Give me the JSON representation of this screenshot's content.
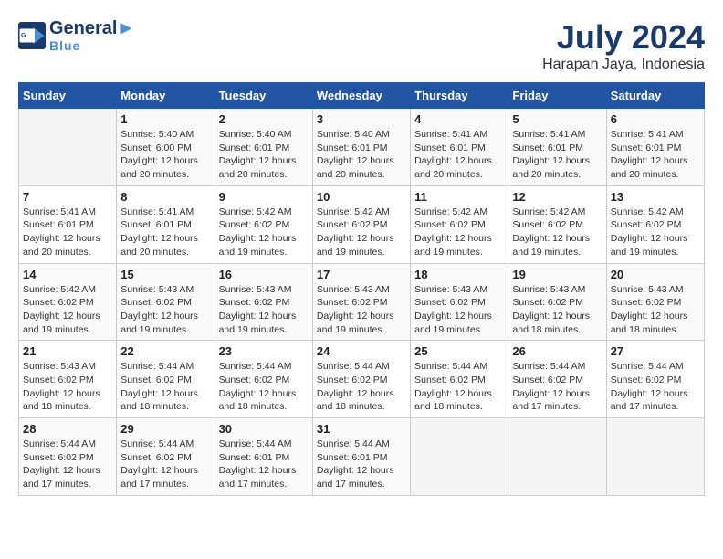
{
  "header": {
    "logo_line1": "General",
    "logo_line2": "Blue",
    "month": "July 2024",
    "location": "Harapan Jaya, Indonesia"
  },
  "weekdays": [
    "Sunday",
    "Monday",
    "Tuesday",
    "Wednesday",
    "Thursday",
    "Friday",
    "Saturday"
  ],
  "weeks": [
    [
      {
        "day": "",
        "info": ""
      },
      {
        "day": "1",
        "info": "Sunrise: 5:40 AM\nSunset: 6:00 PM\nDaylight: 12 hours\nand 20 minutes."
      },
      {
        "day": "2",
        "info": "Sunrise: 5:40 AM\nSunset: 6:01 PM\nDaylight: 12 hours\nand 20 minutes."
      },
      {
        "day": "3",
        "info": "Sunrise: 5:40 AM\nSunset: 6:01 PM\nDaylight: 12 hours\nand 20 minutes."
      },
      {
        "day": "4",
        "info": "Sunrise: 5:41 AM\nSunset: 6:01 PM\nDaylight: 12 hours\nand 20 minutes."
      },
      {
        "day": "5",
        "info": "Sunrise: 5:41 AM\nSunset: 6:01 PM\nDaylight: 12 hours\nand 20 minutes."
      },
      {
        "day": "6",
        "info": "Sunrise: 5:41 AM\nSunset: 6:01 PM\nDaylight: 12 hours\nand 20 minutes."
      }
    ],
    [
      {
        "day": "7",
        "info": "Sunrise: 5:41 AM\nSunset: 6:01 PM\nDaylight: 12 hours\nand 20 minutes."
      },
      {
        "day": "8",
        "info": "Sunrise: 5:41 AM\nSunset: 6:01 PM\nDaylight: 12 hours\nand 20 minutes."
      },
      {
        "day": "9",
        "info": "Sunrise: 5:42 AM\nSunset: 6:02 PM\nDaylight: 12 hours\nand 19 minutes."
      },
      {
        "day": "10",
        "info": "Sunrise: 5:42 AM\nSunset: 6:02 PM\nDaylight: 12 hours\nand 19 minutes."
      },
      {
        "day": "11",
        "info": "Sunrise: 5:42 AM\nSunset: 6:02 PM\nDaylight: 12 hours\nand 19 minutes."
      },
      {
        "day": "12",
        "info": "Sunrise: 5:42 AM\nSunset: 6:02 PM\nDaylight: 12 hours\nand 19 minutes."
      },
      {
        "day": "13",
        "info": "Sunrise: 5:42 AM\nSunset: 6:02 PM\nDaylight: 12 hours\nand 19 minutes."
      }
    ],
    [
      {
        "day": "14",
        "info": "Sunrise: 5:42 AM\nSunset: 6:02 PM\nDaylight: 12 hours\nand 19 minutes."
      },
      {
        "day": "15",
        "info": "Sunrise: 5:43 AM\nSunset: 6:02 PM\nDaylight: 12 hours\nand 19 minutes."
      },
      {
        "day": "16",
        "info": "Sunrise: 5:43 AM\nSunset: 6:02 PM\nDaylight: 12 hours\nand 19 minutes."
      },
      {
        "day": "17",
        "info": "Sunrise: 5:43 AM\nSunset: 6:02 PM\nDaylight: 12 hours\nand 19 minutes."
      },
      {
        "day": "18",
        "info": "Sunrise: 5:43 AM\nSunset: 6:02 PM\nDaylight: 12 hours\nand 19 minutes."
      },
      {
        "day": "19",
        "info": "Sunrise: 5:43 AM\nSunset: 6:02 PM\nDaylight: 12 hours\nand 18 minutes."
      },
      {
        "day": "20",
        "info": "Sunrise: 5:43 AM\nSunset: 6:02 PM\nDaylight: 12 hours\nand 18 minutes."
      }
    ],
    [
      {
        "day": "21",
        "info": "Sunrise: 5:43 AM\nSunset: 6:02 PM\nDaylight: 12 hours\nand 18 minutes."
      },
      {
        "day": "22",
        "info": "Sunrise: 5:44 AM\nSunset: 6:02 PM\nDaylight: 12 hours\nand 18 minutes."
      },
      {
        "day": "23",
        "info": "Sunrise: 5:44 AM\nSunset: 6:02 PM\nDaylight: 12 hours\nand 18 minutes."
      },
      {
        "day": "24",
        "info": "Sunrise: 5:44 AM\nSunset: 6:02 PM\nDaylight: 12 hours\nand 18 minutes."
      },
      {
        "day": "25",
        "info": "Sunrise: 5:44 AM\nSunset: 6:02 PM\nDaylight: 12 hours\nand 18 minutes."
      },
      {
        "day": "26",
        "info": "Sunrise: 5:44 AM\nSunset: 6:02 PM\nDaylight: 12 hours\nand 17 minutes."
      },
      {
        "day": "27",
        "info": "Sunrise: 5:44 AM\nSunset: 6:02 PM\nDaylight: 12 hours\nand 17 minutes."
      }
    ],
    [
      {
        "day": "28",
        "info": "Sunrise: 5:44 AM\nSunset: 6:02 PM\nDaylight: 12 hours\nand 17 minutes."
      },
      {
        "day": "29",
        "info": "Sunrise: 5:44 AM\nSunset: 6:02 PM\nDaylight: 12 hours\nand 17 minutes."
      },
      {
        "day": "30",
        "info": "Sunrise: 5:44 AM\nSunset: 6:01 PM\nDaylight: 12 hours\nand 17 minutes."
      },
      {
        "day": "31",
        "info": "Sunrise: 5:44 AM\nSunset: 6:01 PM\nDaylight: 12 hours\nand 17 minutes."
      },
      {
        "day": "",
        "info": ""
      },
      {
        "day": "",
        "info": ""
      },
      {
        "day": "",
        "info": ""
      }
    ]
  ]
}
